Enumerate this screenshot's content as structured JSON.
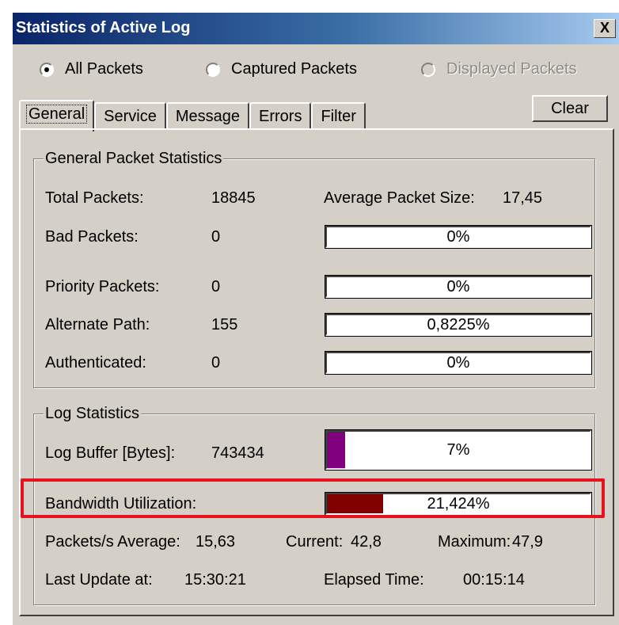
{
  "window": {
    "title": "Statistics of Active Log",
    "close_label": "X"
  },
  "filter_radios": [
    {
      "label": "All Packets",
      "selected": true,
      "enabled": true
    },
    {
      "label": "Captured Packets",
      "selected": false,
      "enabled": true
    },
    {
      "label": "Displayed Packets",
      "selected": false,
      "enabled": false
    }
  ],
  "tabs": [
    "General",
    "Service",
    "Message",
    "Errors",
    "Filter"
  ],
  "active_tab": "General",
  "clear_label": "Clear",
  "general": {
    "legend": "General Packet Statistics",
    "total_packets_label": "Total Packets:",
    "total_packets_value": "18845",
    "avg_size_label": "Average Packet Size:",
    "avg_size_value": "17,45",
    "rows": [
      {
        "label": "Bad Packets:",
        "value": "0",
        "percent_text": "0%",
        "percent": 0
      },
      {
        "label": "Priority Packets:",
        "value": "0",
        "percent_text": "0%",
        "percent": 0
      },
      {
        "label": "Alternate Path:",
        "value": "155",
        "percent_text": "0,8225%",
        "percent": 0.8225
      },
      {
        "label": "Authenticated:",
        "value": "0",
        "percent_text": "0%",
        "percent": 0
      }
    ]
  },
  "log": {
    "legend": "Log Statistics",
    "buffer_label": "Log Buffer [Bytes]:",
    "buffer_value": "743434",
    "buffer_percent_text": "7%",
    "buffer_percent": 7,
    "buffer_color": "#800080",
    "bandwidth_label": "Bandwidth Utilization:",
    "bandwidth_percent_text": "21,424%",
    "bandwidth_percent": 21.424,
    "bandwidth_color": "#800000",
    "packets_avg_label": "Packets/s Average:",
    "packets_avg_value": "15,63",
    "current_label": "Current:",
    "current_value": "42,8",
    "maximum_label": "Maximum:",
    "maximum_value": "47,9",
    "last_update_label": "Last Update at:",
    "last_update_value": "15:30:21",
    "elapsed_label": "Elapsed Time:",
    "elapsed_value": "00:15:14"
  },
  "highlight_color": "#e3141e"
}
